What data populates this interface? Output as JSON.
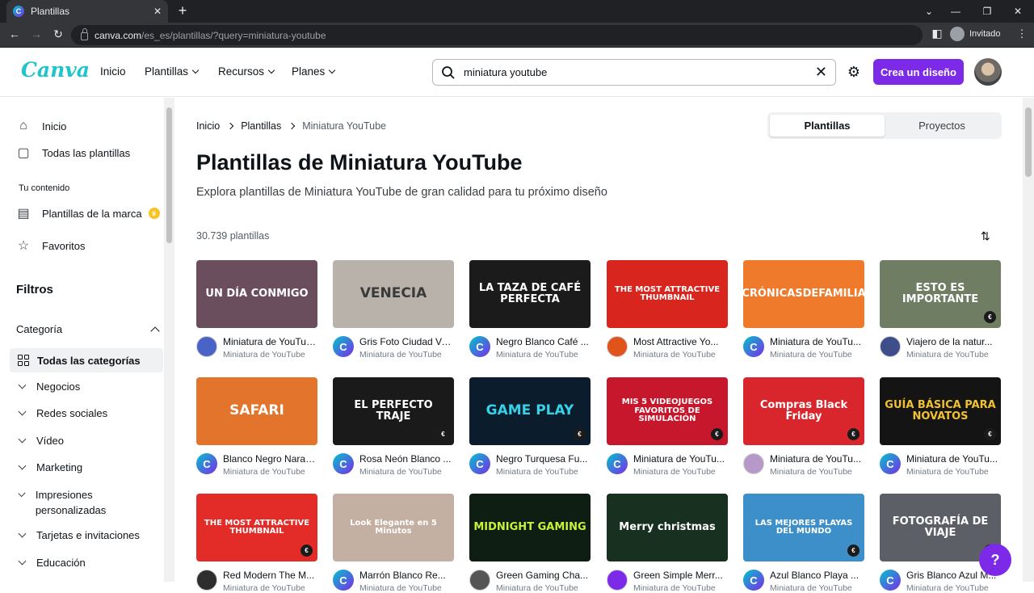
{
  "browser": {
    "tab_title": "Plantillas",
    "url_host": "canva.com",
    "url_path": "/es_es/plantillas/?query=miniatura-youtube",
    "profile_label": "Invitado"
  },
  "header": {
    "logo": "Canva",
    "nav": [
      "Inicio",
      "Plantillas",
      "Recursos",
      "Planes"
    ],
    "search_value": "miniatura youtube",
    "cta_label": "Crea un diseño"
  },
  "sidebar": {
    "top_items": [
      "Inicio",
      "Todas las plantillas"
    ],
    "section_label": "Tu contenido",
    "content_items": [
      "Plantillas de la marca",
      "Favoritos"
    ],
    "filters_title": "Filtros",
    "category_label": "Categoría",
    "all_categories": "Todas las categorías",
    "categories": [
      "Negocios",
      "Redes sociales",
      "Vídeo",
      "Marketing",
      "Impresiones personalizadas",
      "Tarjetas e invitaciones",
      "Educación"
    ]
  },
  "main": {
    "breadcrumb": [
      "Inicio",
      "Plantillas",
      "Miniatura YouTube"
    ],
    "toggle": [
      "Plantillas",
      "Proyectos"
    ],
    "title": "Plantillas de Miniatura YouTube",
    "subtitle": "Explora plantillas de Miniatura YouTube de gran calidad para tu próximo diseño",
    "count": "30.739 plantillas",
    "cards": [
      {
        "title": "Miniatura de YouTube...",
        "type": "Miniatura de YouTube",
        "thumb_text": "UN DÍA CONMIGO",
        "bg": "#6b4e5e",
        "fg": "#ffffff",
        "badge": "",
        "avatar_color": "#4a63c7"
      },
      {
        "title": "Gris Foto Ciudad Ve...",
        "type": "Miniatura de YouTube",
        "thumb_text": "VENECIA",
        "bg": "#b8b2ab",
        "fg": "#3a3a3a",
        "badge": "",
        "avatar_color": "canva"
      },
      {
        "title": "Negro Blanco Café ...",
        "type": "Miniatura de YouTube",
        "thumb_text": "LA TAZA DE CAFÉ PERFECTA",
        "bg": "#1b1b1b",
        "fg": "#ffffff",
        "badge": "",
        "avatar_color": "canva"
      },
      {
        "title": "Most Attractive Yo...",
        "type": "Miniatura de YouTube",
        "thumb_text": "THE MOST ATTRACTIVE THUMBNAIL",
        "bg": "#d8261f",
        "fg": "#ffffff",
        "badge": "",
        "avatar_color": "#e0541c"
      },
      {
        "title": "Miniatura de YouTu...",
        "type": "Miniatura de YouTube",
        "thumb_text": "CRÓNICASDEFAMILIA",
        "bg": "#f07a2b",
        "fg": "#ffffff",
        "badge": "",
        "avatar_color": "canva"
      },
      {
        "title": "Viajero de la natur...",
        "type": "Miniatura de YouTube",
        "thumb_text": "ESTO ES IMPORTANTE",
        "bg": "#6f7d63",
        "fg": "#ffffff",
        "badge": "€",
        "avatar_color": "#3d4e8a"
      },
      {
        "title": "Blanco Negro Naranj...",
        "type": "Miniatura de YouTube",
        "thumb_text": "SAFARI",
        "bg": "#e2742c",
        "fg": "#ffffff",
        "badge": "",
        "avatar_color": "canva"
      },
      {
        "title": "Rosa Neón Blanco ...",
        "type": "Miniatura de YouTube",
        "thumb_text": "EL PERFECTO TRAJE",
        "bg": "#1a1a1a",
        "fg": "#ffffff",
        "badge": "€",
        "avatar_color": "canva"
      },
      {
        "title": "Negro Turquesa Fu...",
        "type": "Miniatura de YouTube",
        "thumb_text": "GAME PLAY",
        "bg": "#0b1c2c",
        "fg": "#35d2e8",
        "badge": "€",
        "avatar_color": "canva"
      },
      {
        "title": "Miniatura de YouTu...",
        "type": "Miniatura de YouTube",
        "thumb_text": "MIS 5 VIDEOJUEGOS FAVORITOS DE SIMULACIÓN",
        "bg": "#c7172c",
        "fg": "#ffffff",
        "badge": "€",
        "avatar_color": "canva"
      },
      {
        "title": "Miniatura de YouTu...",
        "type": "Miniatura de YouTube",
        "thumb_text": "Compras Black Friday",
        "bg": "#d9262c",
        "fg": "#ffffff",
        "badge": "€",
        "avatar_color": "#b799c9"
      },
      {
        "title": "Miniatura de YouTu...",
        "type": "Miniatura de YouTube",
        "thumb_text": "GUÍA BÁSICA PARA NOVATOS",
        "bg": "#141414",
        "fg": "#f2c12e",
        "badge": "€",
        "avatar_color": "canva"
      },
      {
        "title": "Red Modern The M...",
        "type": "Miniatura de YouTube",
        "thumb_text": "THE MOST ATTRACTIVE THUMBNAIL",
        "bg": "#e32b27",
        "fg": "#ffffff",
        "badge": "€",
        "avatar_color": "#2e2e2e"
      },
      {
        "title": "Marrón Blanco Re...",
        "type": "Miniatura de YouTube",
        "thumb_text": "Look Elegante en 5 Minutos",
        "bg": "#c4b0a3",
        "fg": "#ffffff",
        "badge": "",
        "avatar_color": "canva"
      },
      {
        "title": "Green Gaming Cha...",
        "type": "Miniatura de YouTube",
        "thumb_text": "MIDNIGHT GAMING",
        "bg": "#0f1e12",
        "fg": "#c7f23a",
        "badge": "",
        "avatar_color": "#555555"
      },
      {
        "title": "Green Simple Merr...",
        "type": "Miniatura de YouTube",
        "thumb_text": "Merry christmas",
        "bg": "#17301f",
        "fg": "#ffffff",
        "badge": "",
        "avatar_color": "#7d2ae8"
      },
      {
        "title": "Azul Blanco Playa ...",
        "type": "Miniatura de YouTube",
        "thumb_text": "LAS MEJORES PLAYAS DEL MUNDO",
        "bg": "#3c8fc9",
        "fg": "#ffffff",
        "badge": "€",
        "avatar_color": "canva"
      },
      {
        "title": "Gris Blanco Azul M...",
        "type": "Miniatura de YouTube",
        "thumb_text": "FOTOGRAFÍA DE VIAJE",
        "bg": "#5c6066",
        "fg": "#ffffff",
        "badge": "€",
        "avatar_color": "canva"
      }
    ]
  },
  "help_label": "?"
}
